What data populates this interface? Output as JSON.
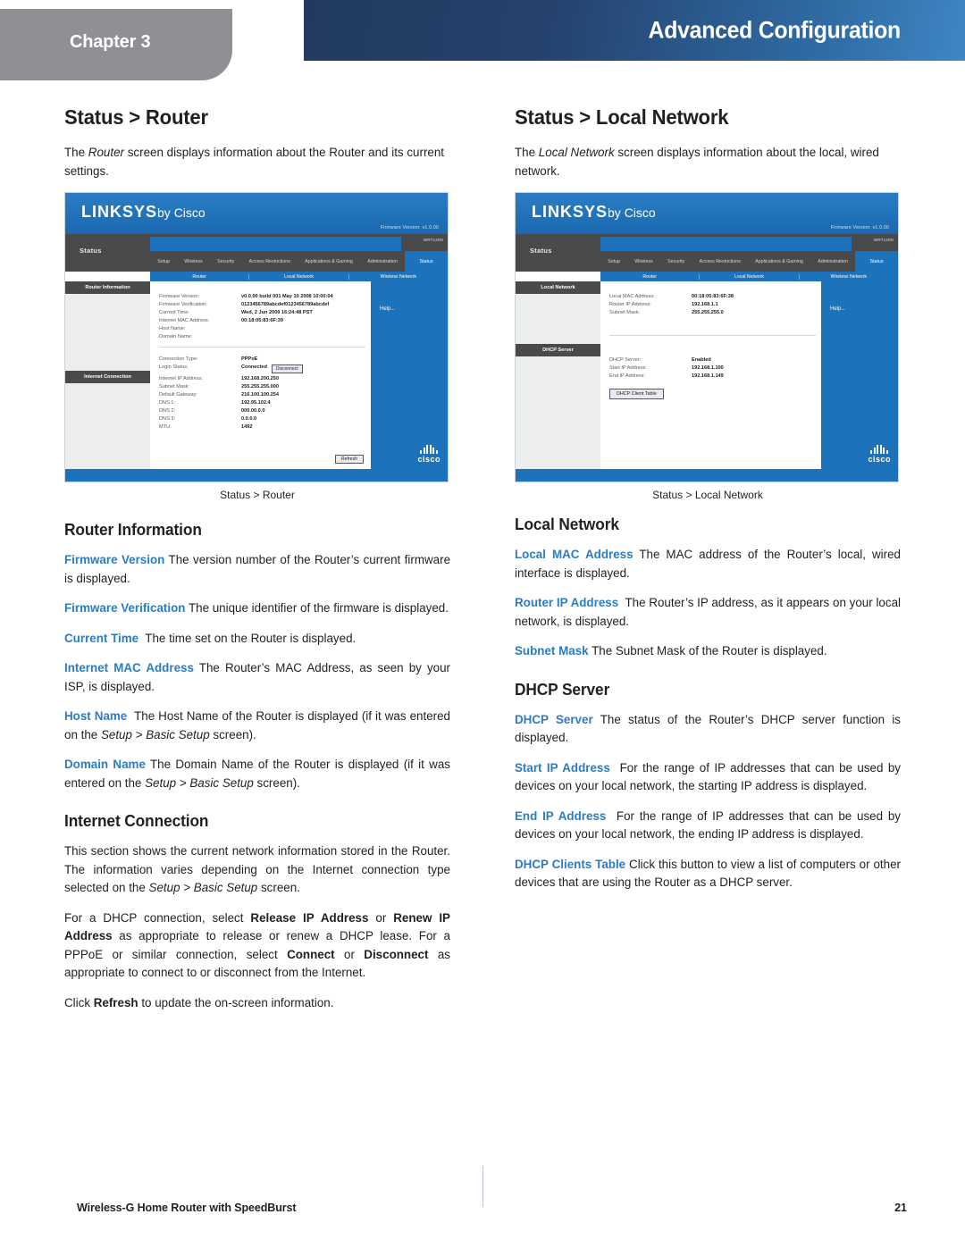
{
  "header": {
    "chapter_label": "Chapter 3",
    "title": "Advanced Configuration",
    "gradient_from": "#223a5e",
    "gradient_to": "#3e86c4",
    "chapter_tab_color": "#8e9094"
  },
  "colors": {
    "term_blue": "#2b7cc4",
    "body_text": "#231f20"
  },
  "left_column": {
    "section_title": "Status > Router",
    "intro_parts": [
      "The ",
      "Router",
      " screen displays information about the Router and its current settings."
    ],
    "figure_caption": "Status > Router",
    "router_information": {
      "heading": "Router Information",
      "terms": [
        {
          "label": "Firmware Version",
          "text": "The version number of the Router’s current firmware is displayed."
        },
        {
          "label": "Firmware Verification",
          "text": "The unique identifier of the firmware is displayed."
        },
        {
          "label": "Current Time",
          "text": "The time set on the Router is displayed."
        },
        {
          "label": "Internet MAC Address",
          "text": "The Router’s MAC Address, as seen by your ISP, is displayed."
        }
      ],
      "host_name": {
        "label": "Host Name",
        "pre": "The Host Name of the Router is displayed (if it was entered on the ",
        "italic": "Setup > Basic Setup",
        "post": " screen)."
      },
      "domain_name": {
        "label": "Domain Name",
        "pre": "The Domain Name of the Router is displayed (if it was entered on the ",
        "italic": "Setup > Basic Setup",
        "post": " screen)."
      }
    },
    "internet_connection": {
      "heading": "Internet Connection",
      "para1_pre": "This section shows the current network information stored in the Router. The information varies depending on the Internet connection type selected on the ",
      "para1_italic": "Setup > Basic Setup",
      "para1_post": " screen.",
      "para2_a": "For a DHCP connection, select ",
      "para2_b1": "Release IP Address",
      "para2_c": " or ",
      "para2_b2": "Renew IP Address",
      "para2_d": " as appropriate to release or renew a DHCP lease. For a PPPoE or similar connection, select ",
      "para2_b3": "Connect",
      "para2_e": " or ",
      "para2_b4": "Disconnect",
      "para2_f": " as appropriate to connect to or disconnect from the Internet.",
      "para3_a": "Click ",
      "para3_b": "Refresh",
      "para3_c": " to update the on-screen information."
    }
  },
  "right_column": {
    "section_title": "Status > Local Network",
    "intro_parts": [
      "The ",
      "Local Network",
      " screen displays information about the local, wired network."
    ],
    "figure_caption": "Status > Local Network",
    "local_network": {
      "heading": "Local Network",
      "terms": [
        {
          "label": "Local MAC Address",
          "text": "The MAC address of the Router’s local, wired interface is displayed."
        },
        {
          "label": "Router IP Address",
          "text": "The Router’s IP address, as it appears on your local network, is displayed."
        },
        {
          "label": "Subnet Mask",
          "text": "The Subnet Mask of the Router is displayed."
        }
      ]
    },
    "dhcp_server": {
      "heading": "DHCP Server",
      "terms": [
        {
          "label": "DHCP Server",
          "text": "The status of the Router’s DHCP server function is displayed."
        },
        {
          "label": "Start IP Address",
          "text": "For the range of IP addresses that can be used by devices on your local network, the starting IP address is displayed."
        },
        {
          "label": "End IP Address",
          "text": "For the range of IP addresses that can be used by devices on your local network, the ending IP address is displayed."
        },
        {
          "label": "DHCP Clients Table",
          "text": "Click this button to view a list of computers or other devices that are using the Router as a DHCP server."
        }
      ]
    }
  },
  "router_ui": {
    "brand": "LINKSYS",
    "brand_suffix": "by Cisco",
    "firmware_note": "Firmware Version: v1.0.00",
    "model_badge": "WRT120N",
    "side_title": "Status",
    "nav_tabs": [
      "Setup",
      "Wireless",
      "Security",
      "Access Restrictions",
      "Applications & Gaming",
      "Administration",
      "Status"
    ],
    "active_nav_tab": "Status",
    "sub_tabs": [
      "Router",
      "Local Network",
      "Wireless Network"
    ],
    "help_label": "Help...",
    "cisco_word": "cisco",
    "router_screen": {
      "sidebar_sections": [
        "Router Information",
        "Internet Connection"
      ],
      "router_info_rows": [
        {
          "key": "Firmware Version:",
          "value": "v0.0.00 build 001 May 10 2008 10:00:04"
        },
        {
          "key": "Firmware Verification:",
          "value": "0123456789abcdef0123456789abcdef"
        },
        {
          "key": "Current Time:",
          "value": "Wed, 2 Jun 2009  16:24:48 PST"
        },
        {
          "key": "Internet MAC Address:",
          "value": "00:18:05:83:6F:39"
        },
        {
          "key": "Host Name:",
          "value": ""
        },
        {
          "key": "Domain Name:",
          "value": ""
        }
      ],
      "internet_rows": [
        {
          "key": "Connection Type:",
          "value": "PPPoE"
        },
        {
          "key": "Login Status:",
          "value": "Connected",
          "button": "Disconnect"
        },
        {
          "key": "Internet IP Address:",
          "value": "192.168.200.250"
        },
        {
          "key": "Subnet Mask:",
          "value": "255.255.255.000"
        },
        {
          "key": "Default Gateway:",
          "value": "216.100.100.254"
        },
        {
          "key": "DNS 1:",
          "value": "192.95.102.4"
        },
        {
          "key": "DNS 2:",
          "value": "000.00.0.0"
        },
        {
          "key": "DNS 3:",
          "value": "0.0.0.0"
        },
        {
          "key": "MTU:",
          "value": "1492"
        }
      ],
      "refresh_button": "Refresh"
    },
    "local_network_screen": {
      "sidebar_sections": [
        "Local Network",
        "DHCP Server"
      ],
      "local_rows": [
        {
          "key": "Local MAC Address:",
          "value": "00:18:05:83:6F:38"
        },
        {
          "key": "Router IP Address:",
          "value": "192.168.1.1"
        },
        {
          "key": "Subnet Mask:",
          "value": "255.255.255.0"
        }
      ],
      "dhcp_rows": [
        {
          "key": "DHCP Server:",
          "value": "Enabled"
        },
        {
          "key": "Start IP Address:",
          "value": "192.168.1.100"
        },
        {
          "key": "End IP Address:",
          "value": "192.168.1.149"
        }
      ],
      "clients_button": "DHCP Client Table"
    }
  },
  "footer": {
    "product": "Wireless-G Home Router with SpeedBurst",
    "page_number": "21"
  }
}
